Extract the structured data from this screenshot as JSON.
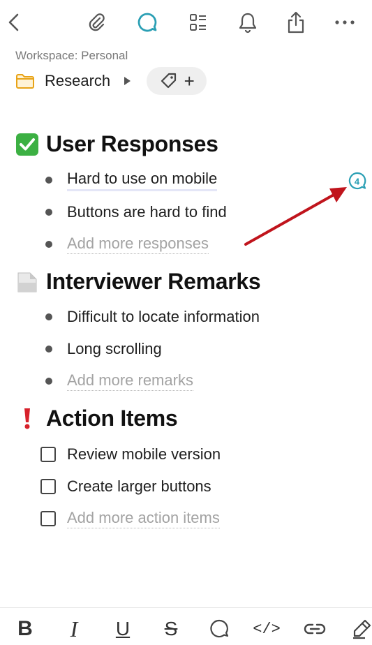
{
  "toolbar": {
    "icons": [
      "back-icon",
      "attachment-icon",
      "comment-icon",
      "outline-icon",
      "bell-icon",
      "share-icon",
      "more-icon"
    ],
    "accent_color": "#2a9fb4"
  },
  "workspace_label": "Workspace: Personal",
  "breadcrumb": {
    "folder_label": "Research",
    "tag_plus": "+"
  },
  "sections": {
    "responses": {
      "emoji": "white-check-mark",
      "title": "User Responses",
      "items": [
        "Hard to use on mobile",
        "Buttons are hard to find"
      ],
      "placeholder": "Add more responses",
      "comment_count": "4"
    },
    "remarks": {
      "emoji": "page-icon",
      "title": "Interviewer Remarks",
      "items": [
        "Difficult to locate information",
        "Long scrolling"
      ],
      "placeholder": "Add more remarks"
    },
    "actions": {
      "emoji": "exclamation-mark",
      "title": "Action Items",
      "items": [
        "Review mobile version",
        "Create larger buttons"
      ],
      "placeholder": "Add more action items"
    }
  },
  "format_bar": {
    "bold": "B",
    "italic": "I",
    "underline": "U",
    "strike": "S",
    "code": "</>"
  },
  "annotation_color": "#c0141c"
}
